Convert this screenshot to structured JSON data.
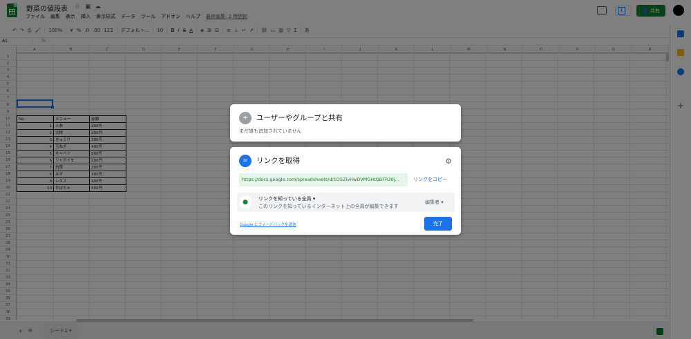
{
  "header": {
    "doc_title": "野菜の値段表",
    "menu": [
      "ファイル",
      "編集",
      "表示",
      "挿入",
      "表示形式",
      "データ",
      "ツール",
      "アドオン",
      "ヘルプ"
    ],
    "last_edit": "最終編集: 2 時間前",
    "share_label": "共有"
  },
  "toolbar": {
    "zoom": "100%",
    "currency": "¥",
    "percent": "%",
    "dec_less": ".0",
    "dec_more": ".00",
    "more_formats": "123",
    "font": "デフォルト...",
    "font_size": "10",
    "bold": "B",
    "italic": "I",
    "strike": "S",
    "text_color": "A",
    "input_tools": "あ"
  },
  "formula_bar": {
    "name_box": "A1",
    "fx": "fx"
  },
  "grid": {
    "columns": [
      "A",
      "B",
      "C",
      "D",
      "E",
      "F",
      "G",
      "H",
      "I",
      "J",
      "K",
      "L",
      "M",
      "N",
      "O",
      "P",
      "Q",
      "R"
    ],
    "rows": [
      "1",
      "2",
      "3",
      "4",
      "5",
      "6",
      "7",
      "8",
      "9",
      "10",
      "11",
      "12",
      "13",
      "14",
      "15",
      "16",
      "17",
      "18",
      "19",
      "20",
      "21",
      "22",
      "23",
      "24",
      "25",
      "26",
      "27",
      "28",
      "29",
      "30",
      "31",
      "32",
      "33",
      "34",
      "35",
      "36",
      "37",
      "38",
      "39"
    ],
    "table_header": [
      "No.",
      "メニュー",
      "金額"
    ],
    "table_rows": [
      [
        "1",
        "人参",
        "200円"
      ],
      [
        "2",
        "大根",
        "200円"
      ],
      [
        "3",
        "きゅうり",
        "300円"
      ],
      [
        "4",
        "玉ねぎ",
        "400円"
      ],
      [
        "5",
        "キャベツ",
        "500円"
      ],
      [
        "6",
        "ジャガイモ",
        "100円"
      ],
      [
        "7",
        "白菜",
        "200円"
      ],
      [
        "8",
        "ネギ",
        "300円"
      ],
      [
        "9",
        "レタス",
        "400円"
      ],
      [
        "10",
        "かぼちゃ",
        "500円"
      ]
    ]
  },
  "sheets": {
    "add": "+",
    "list": "≡",
    "tab": "シート1 ▾"
  },
  "share_dialog": {
    "title": "ユーザーやグループと共有",
    "subtitle": "まだ誰も追加されていません"
  },
  "link_dialog": {
    "title": "リンクを取得",
    "url": "https://docs.google.com/spreadsheets/d/1DSZlvHwDVMGHtQBFR30j...",
    "copy_label": "リンクをコピー",
    "access_title": "リンクを知っている全員 ▾",
    "access_desc": "このリンクを知っているインターネット上の全員が編集できます",
    "role": "編集者 ▾",
    "feedback": "Google にフィードバックを送信",
    "done": "完了"
  }
}
